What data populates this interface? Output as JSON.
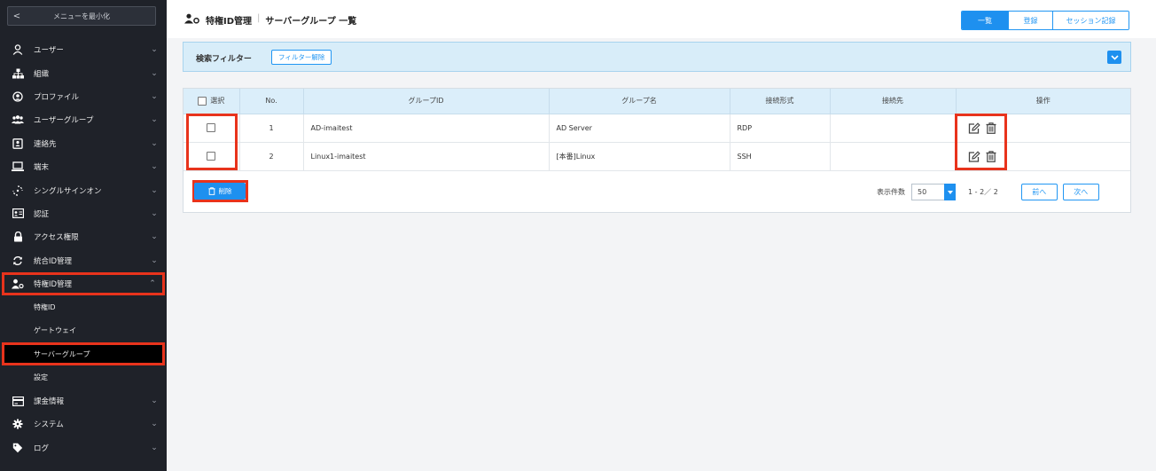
{
  "sidebar": {
    "collapse_label": "メニューを最小化",
    "collapse_chevron": "<",
    "items": [
      {
        "label": "ユーザー",
        "icon": "user-icon"
      },
      {
        "label": "組織",
        "icon": "org-icon"
      },
      {
        "label": "プロファイル",
        "icon": "profile-icon"
      },
      {
        "label": "ユーザーグループ",
        "icon": "user-group-icon"
      },
      {
        "label": "連絡先",
        "icon": "contact-icon"
      },
      {
        "label": "端末",
        "icon": "laptop-icon"
      },
      {
        "label": "シングルサインオン",
        "icon": "sso-icon"
      },
      {
        "label": "認証",
        "icon": "auth-icon"
      },
      {
        "label": "アクセス権限",
        "icon": "lock-icon"
      },
      {
        "label": "統合ID管理",
        "icon": "sync-icon"
      },
      {
        "label": "特権ID管理",
        "icon": "privileged-id-icon"
      }
    ],
    "sub_items": [
      "特権ID",
      "ゲートウェイ",
      "サーバーグループ",
      "設定"
    ],
    "bottom_items": [
      {
        "label": "課金情報",
        "icon": "billing-icon"
      },
      {
        "label": "システム",
        "icon": "gear-icon"
      },
      {
        "label": "ログ",
        "icon": "tag-icon"
      }
    ]
  },
  "header": {
    "section": "特権ID管理",
    "separator": "|",
    "title": "サーバーグループ 一覧",
    "tabs": [
      "一覧",
      "登録",
      "セッション記録"
    ]
  },
  "filter": {
    "label": "検索フィルター",
    "reset_label": "フィルター解除"
  },
  "table": {
    "headers": [
      "選択",
      "No.",
      "グループID",
      "グループ名",
      "接続形式",
      "接続先",
      "操作"
    ],
    "rows": [
      {
        "no": "1",
        "group_id": "AD-imaitest",
        "group_name": "AD Server",
        "conn_type": "RDP",
        "dest": ""
      },
      {
        "no": "2",
        "group_id": "Linux1-imaitest",
        "group_name": "[本番]Linux",
        "conn_type": "SSH",
        "dest": ""
      }
    ]
  },
  "footer": {
    "delete_label": "削除",
    "per_page_label": "表示件数",
    "per_page_value": "50",
    "range": "1 - 2／ 2",
    "prev_label": "前へ",
    "next_label": "次へ"
  },
  "colors": {
    "accent": "#1e90ef",
    "highlight": "#e8331c",
    "sidebar_bg": "#1f2229"
  }
}
